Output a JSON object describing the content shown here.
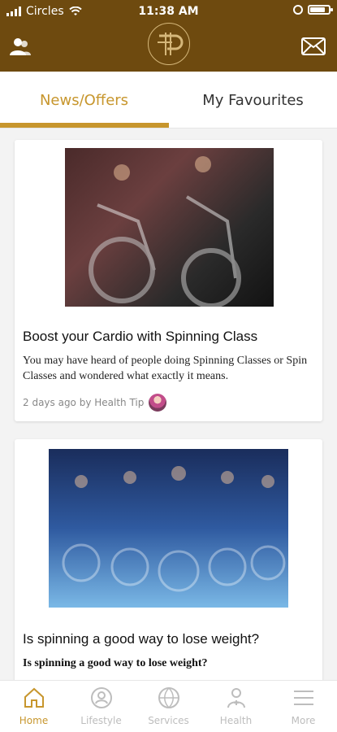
{
  "status_bar": {
    "carrier": "Circles",
    "time": "11:38 AM"
  },
  "colors": {
    "header_brown": "#6e4a0f",
    "accent_gold": "#c7962d"
  },
  "icons": {
    "left_header": "profile-icon",
    "right_header": "mail-icon",
    "brand_logo": "logo-icon"
  },
  "tabs": [
    {
      "label": "News/Offers",
      "active": true
    },
    {
      "label": "My Favourites",
      "active": false
    }
  ],
  "feed": [
    {
      "title": "Boost your Cardio with Spinning Class",
      "description": "You may have heard of people doing Spinning Classes or Spin Classes and wondered what exactly it means.",
      "meta": "2 days ago by Health  Tip"
    },
    {
      "title": "Is spinning a good way to lose weight?",
      "description": "Is spinning a good way to lose weight?"
    }
  ],
  "bottom_nav": [
    {
      "label": "Home",
      "active": true,
      "icon": "home-icon"
    },
    {
      "label": "Lifestyle",
      "active": false,
      "icon": "lifestyle-icon"
    },
    {
      "label": "Services",
      "active": false,
      "icon": "services-icon"
    },
    {
      "label": "Health",
      "active": false,
      "icon": "health-icon"
    },
    {
      "label": "More",
      "active": false,
      "icon": "menu-icon"
    }
  ]
}
